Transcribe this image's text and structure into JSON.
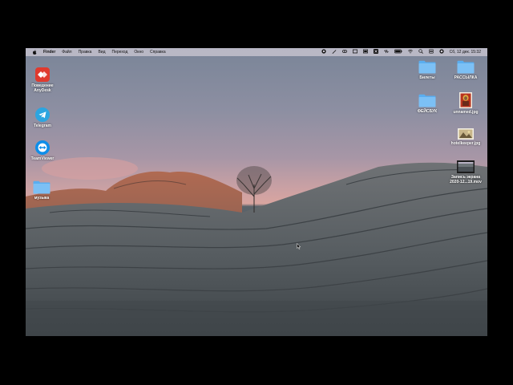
{
  "menubar": {
    "apple": "apple-icon",
    "items": [
      "Finder",
      "Файл",
      "Правка",
      "Вид",
      "Переход",
      "Окно",
      "Справка"
    ],
    "clock": "Сб, 12 дек.  15:32"
  },
  "desktop": {
    "left_icons": [
      {
        "label_line1": "Поведение",
        "label_line2": "AnyDesk",
        "icon": "anydesk-icon"
      },
      {
        "label_line1": "Telegram",
        "label_line2": "",
        "icon": "telegram-icon"
      },
      {
        "label_line1": "TeamViewer",
        "label_line2": "",
        "icon": "teamviewer-icon"
      },
      {
        "label_line1": "музыка",
        "label_line2": "",
        "icon": "folder-icon"
      }
    ],
    "right_icons": [
      {
        "label_line1": "Билеты",
        "label_line2": "",
        "icon": "folder-icon"
      },
      {
        "label_line1": "РАССЫЛКА",
        "label_line2": "",
        "icon": "folder-icon"
      },
      {
        "label_line1": "ФЕЙСБУК",
        "label_line2": "",
        "icon": "folder-icon"
      },
      {
        "label_line1": "unnamed.jpg",
        "label_line2": "",
        "icon": "image-file-icon"
      },
      {
        "label_line1": "hotelkeeper.jpg",
        "label_line2": "",
        "icon": "image-file-icon"
      },
      {
        "label_line1": "Запись экрана",
        "label_line2": "2020-12...19.mov",
        "icon": "video-file-icon"
      }
    ]
  },
  "colors": {
    "folder": "#5aaef0",
    "anydesk": "#e03a2e",
    "telegram": "#2ca5e0",
    "teamviewer": "#0e8ee9"
  }
}
